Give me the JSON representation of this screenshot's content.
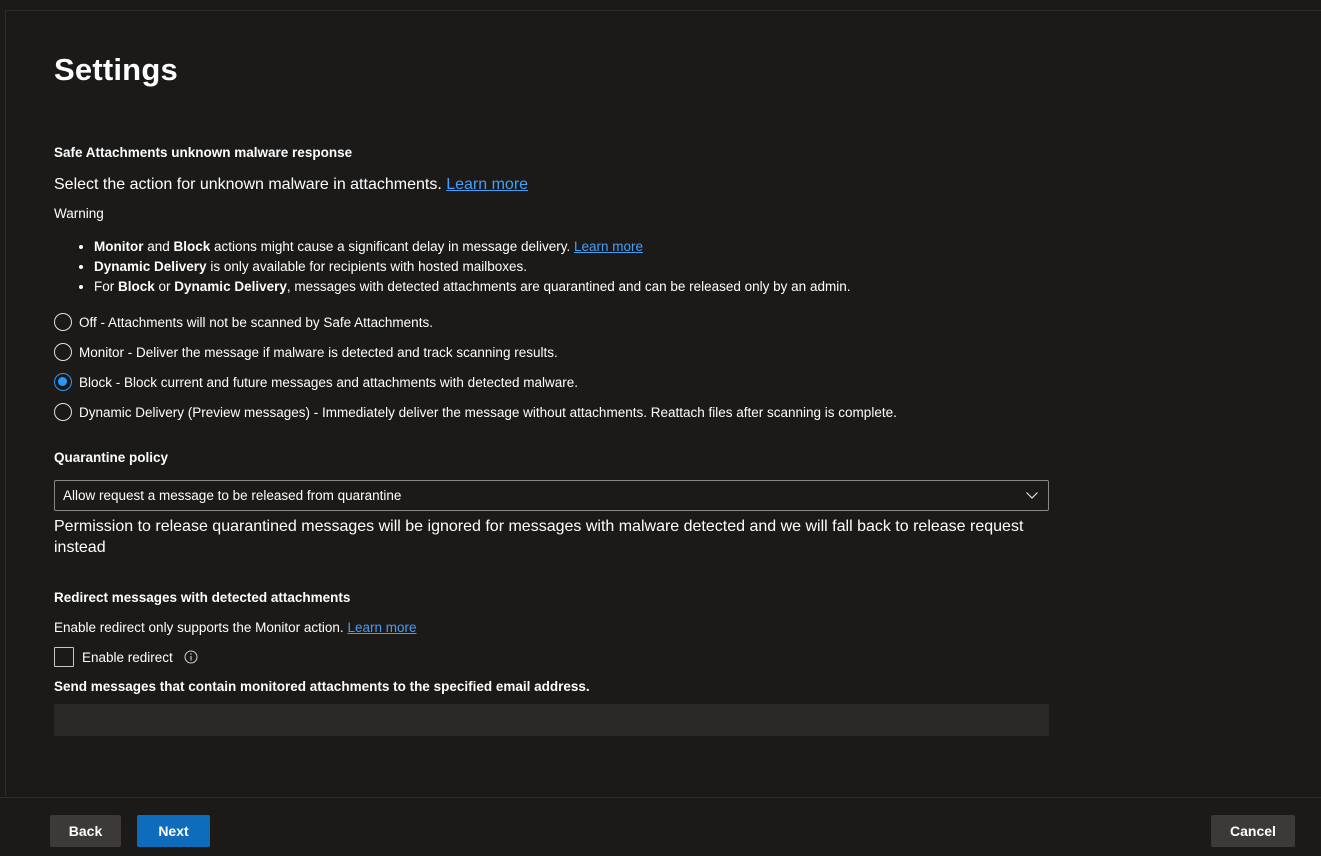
{
  "page": {
    "title": "Settings"
  },
  "safe_attachments": {
    "heading": "Safe Attachments unknown malware response",
    "description": "Select the action for unknown malware in attachments.",
    "learn_more": "Learn more",
    "warning_label": "Warning",
    "warnings": [
      {
        "b1": "Monitor",
        "t1": " and ",
        "b2": "Block",
        "t2": " actions might cause a significant delay in message delivery. ",
        "link": "Learn more"
      },
      {
        "b1": "Dynamic Delivery",
        "t1": " is only available for recipients with hosted mailboxes."
      },
      {
        "t0": "For ",
        "b1": "Block",
        "t1": " or ",
        "b2": "Dynamic Delivery",
        "t2": ", messages with detected attachments are quarantined and can be released only by an admin."
      }
    ],
    "options": [
      {
        "label": "Off - Attachments will not be scanned by Safe Attachments.",
        "selected": false
      },
      {
        "label": "Monitor - Deliver the message if malware is detected and track scanning results.",
        "selected": false
      },
      {
        "label": "Block - Block current and future messages and attachments with detected malware.",
        "selected": true
      },
      {
        "label": "Dynamic Delivery (Preview messages) - Immediately deliver the message without attachments. Reattach files after scanning is complete.",
        "selected": false
      }
    ]
  },
  "quarantine": {
    "heading": "Quarantine policy",
    "selected_value": "Allow request a message to be released from quarantine",
    "note": "Permission to release quarantined messages will be ignored for messages with malware detected and we will fall back to release request instead"
  },
  "redirect": {
    "heading": "Redirect messages with detected attachments",
    "description": "Enable redirect only supports the Monitor action.",
    "learn_more": "Learn more",
    "checkbox_label": "Enable redirect",
    "checkbox_checked": false,
    "email_label": "Send messages that contain monitored attachments to the specified email address.",
    "email_value": ""
  },
  "footer": {
    "back_label": "Back",
    "next_label": "Next",
    "cancel_label": "Cancel"
  },
  "colors": {
    "background": "#1b1a19",
    "accent": "#0f6cbd",
    "link": "#479ef5",
    "radio_selected": "#2899f5"
  }
}
